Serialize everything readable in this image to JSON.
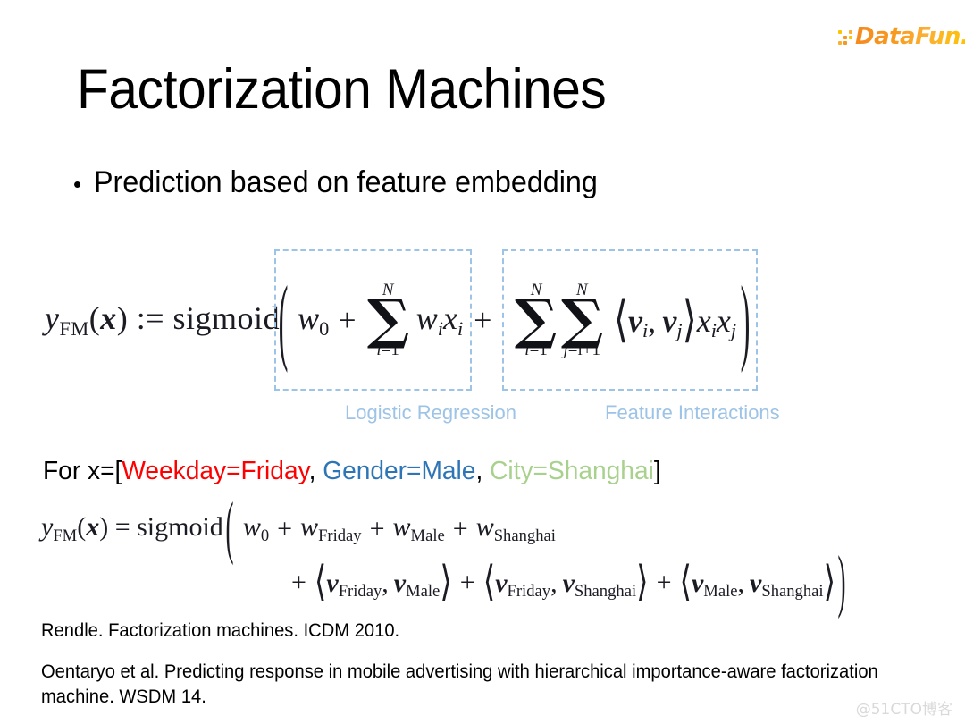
{
  "logo": {
    "text": "DataFun.",
    "dot_colors": [
      "#FDC500",
      "#FBB034",
      "#F79620"
    ]
  },
  "slide": {
    "title": "Factorization Machines",
    "bullet_marker": "•",
    "bullet_text": "Prediction based on feature embedding"
  },
  "formula1": {
    "lead": "y",
    "lead_sub": "FM",
    "lead_arg_open": "(",
    "lead_arg": "x",
    "lead_arg_close": ")",
    "relation": ":=",
    "function": "sigmoid",
    "paren_open": "(",
    "paren_close": ")",
    "lr_term_w0": "w",
    "lr_term_w0_sub": "0",
    "plus1": "+",
    "sum1_upper": "N",
    "sum1_symbol": "∑",
    "sum1_lower_var": "i",
    "sum1_lower_eq": "=1",
    "lr_wi": "w",
    "lr_wi_sub": "i",
    "lr_xi": "x",
    "lr_xi_sub": "i",
    "plus_between": "+",
    "sum2_upper": "N",
    "sum2_symbol": "∑",
    "sum2_lower_var": "i",
    "sum2_lower_eq": "=1",
    "sum3_upper": "N",
    "sum3_symbol": "∑",
    "sum3_lower_var": "j",
    "sum3_lower_eq": "=i+1",
    "angle_open": "⟨",
    "fi_vi": "v",
    "fi_vi_sub": "i",
    "comma": ",",
    "fi_vj": "v",
    "fi_vj_sub": "j",
    "angle_close": "⟩",
    "fi_xi": "x",
    "fi_xi_sub": "i",
    "fi_xj": "x",
    "fi_xj_sub": "j"
  },
  "captions": {
    "logistic_regression": "Logistic Regression",
    "feature_interactions": "Feature Interactions",
    "color": "#9DC3E6"
  },
  "example": {
    "prefix": "For x=[",
    "feature1": "Weekday=Friday",
    "sep1": ", ",
    "feature2": "Gender=Male",
    "sep2": ", ",
    "feature3": "City=Shanghai",
    "suffix": "]",
    "color1": "#FF0000",
    "color2": "#2E75B6",
    "color3": "#A9D18E"
  },
  "formula2": {
    "lead": "y",
    "lead_sub": "FM",
    "arg_open": "(",
    "arg": "x",
    "arg_close": ")",
    "relation": "=",
    "function": "sigmoid",
    "paren_open": "(",
    "paren_close": ")",
    "w0": "w",
    "w0_sub": "0",
    "plus_a": "+",
    "w_friday": "w",
    "w_friday_sub": "Friday",
    "plus_b": "+",
    "w_male": "w",
    "w_male_sub": "Male",
    "plus_c": "+",
    "w_shanghai": "w",
    "w_shanghai_sub": "Shanghai",
    "plus_d": "+",
    "angle_open_1": "⟨",
    "v1a": "v",
    "v1a_sub": "Friday",
    "comma1": ",",
    "v1b": "v",
    "v1b_sub": "Male",
    "angle_close_1": "⟩",
    "plus_e": "+",
    "angle_open_2": "⟨",
    "v2a": "v",
    "v2a_sub": "Friday",
    "comma2": ",",
    "v2b": "v",
    "v2b_sub": "Shanghai",
    "angle_close_2": "⟩",
    "plus_f": "+",
    "angle_open_3": "⟨",
    "v3a": "v",
    "v3a_sub": "Male",
    "comma3": ",",
    "v3b": "v",
    "v3b_sub": "Shanghai",
    "angle_close_3": "⟩"
  },
  "references": {
    "ref1": "Rendle. Factorization machines. ICDM 2010.",
    "ref2": "Oentaryo et al. Predicting response in mobile advertising with hierarchical importance-aware factorization machine. WSDM 14."
  },
  "watermark": "@51CTO博客"
}
